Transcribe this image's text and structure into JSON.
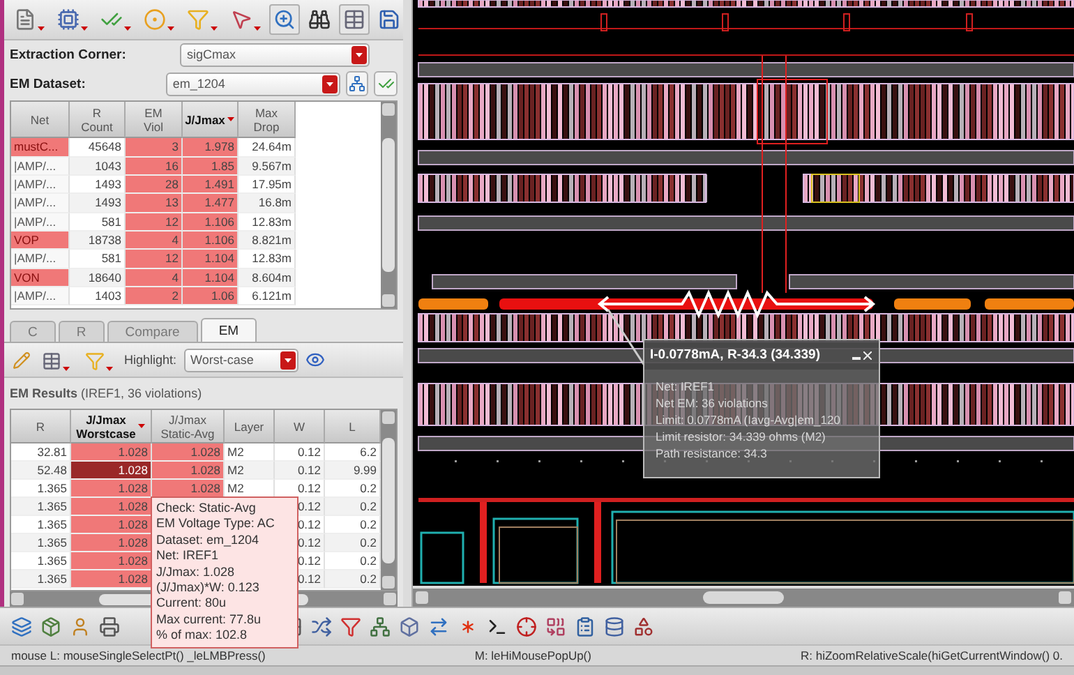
{
  "extraction_corner": {
    "label": "Extraction Corner:",
    "value": "sigCmax"
  },
  "em_dataset": {
    "label": "EM Dataset:",
    "value": "em_1204"
  },
  "net_table": {
    "columns": [
      {
        "label": "Net",
        "highlighted": false,
        "sorted": false
      },
      {
        "label": "R\nCount",
        "highlighted": false,
        "sorted": false
      },
      {
        "label": "EM\nViol",
        "highlighted": true,
        "sorted": false
      },
      {
        "label": "J/Jmax",
        "highlighted": true,
        "sorted": true
      },
      {
        "label": "Max\nDrop",
        "highlighted": false,
        "sorted": false
      }
    ],
    "rows": [
      {
        "cells": [
          "mustC...",
          "45648",
          "3",
          "1.978",
          "24.64m"
        ],
        "flagged": true
      },
      {
        "cells": [
          "|AMP/...",
          "1043",
          "16",
          "1.85",
          "9.567m"
        ],
        "flagged": false
      },
      {
        "cells": [
          "|AMP/...",
          "1493",
          "28",
          "1.491",
          "17.95m"
        ],
        "flagged": false
      },
      {
        "cells": [
          "|AMP/...",
          "1493",
          "13",
          "1.477",
          "16.8m"
        ],
        "flagged": false
      },
      {
        "cells": [
          "|AMP/...",
          "581",
          "12",
          "1.106",
          "12.83m"
        ],
        "flagged": false
      },
      {
        "cells": [
          "VOP",
          "18738",
          "4",
          "1.106",
          "8.821m"
        ],
        "flagged": true
      },
      {
        "cells": [
          "|AMP/...",
          "581",
          "12",
          "1.104",
          "12.83m"
        ],
        "flagged": false
      },
      {
        "cells": [
          "VON",
          "18640",
          "4",
          "1.104",
          "8.604m"
        ],
        "flagged": true
      },
      {
        "cells": [
          "|AMP/...",
          "1403",
          "2",
          "1.06",
          "6.121m"
        ],
        "flagged": false
      }
    ]
  },
  "tabs": [
    {
      "label": "C",
      "selected": false
    },
    {
      "label": "R",
      "selected": false
    },
    {
      "label": "Compare",
      "selected": false
    },
    {
      "label": "EM",
      "selected": true
    }
  ],
  "highlight": {
    "label": "Highlight:",
    "value": "Worst-case"
  },
  "results": {
    "title": "EM Results",
    "detail": "(IREF1, 36 violations)"
  },
  "results_table": {
    "columns": [
      {
        "label": "R",
        "highlighted": false,
        "sorted": false
      },
      {
        "label": "J/Jmax\nWorstcase",
        "highlighted": true,
        "sorted": true
      },
      {
        "label": "J/Jmax\nStatic-Avg",
        "highlighted": true,
        "sorted": false
      },
      {
        "label": "Layer",
        "highlighted": false,
        "sorted": false
      },
      {
        "label": "W",
        "highlighted": false,
        "sorted": false
      },
      {
        "label": "L",
        "highlighted": false,
        "sorted": false
      }
    ],
    "rows": [
      {
        "cells": [
          "32.81",
          "1.028",
          "1.028",
          "M2",
          "0.12",
          "6.2"
        ],
        "selected": false
      },
      {
        "cells": [
          "52.48",
          "1.028",
          "1.028",
          "M2",
          "0.12",
          "9.99"
        ],
        "selected": true
      },
      {
        "cells": [
          "1.365",
          "1.028",
          "1.028",
          "M2",
          "0.12",
          "0.2"
        ],
        "selected": false
      },
      {
        "cells": [
          "1.365",
          "1.028",
          null,
          null,
          "0.12",
          "0.2"
        ],
        "selected": false
      },
      {
        "cells": [
          "1.365",
          "1.028",
          null,
          null,
          "0.12",
          "0.2"
        ],
        "selected": false
      },
      {
        "cells": [
          "1.365",
          "1.028",
          null,
          null,
          "0.12",
          "0.2"
        ],
        "selected": false
      },
      {
        "cells": [
          "1.365",
          "1.028",
          null,
          null,
          "0.12",
          "0.2"
        ],
        "selected": false
      },
      {
        "cells": [
          "1.365",
          "1.028",
          null,
          null,
          "0.12",
          "0.2"
        ],
        "selected": false
      }
    ]
  },
  "tooltip": {
    "lines": [
      "Check: Static-Avg",
      "EM Voltage Type: AC",
      "Dataset: em_1204",
      "Net: IREF1",
      "J/Jmax: 1.028",
      "(J/Jmax)*W: 0.123",
      "Current: 80u",
      "Max current: 77.8u",
      "% of max: 102.8"
    ]
  },
  "canvas_popup": {
    "title": "I-0.0778mA, R-34.3 (34.339)",
    "lines": [
      "Net: IREF1",
      "Net EM: 36 violations",
      "Limit: 0.0778mA (Iavg-Avg|em_120",
      "Limit resistor: 34.339 ohms (M2)",
      "Path resistance: 34.3"
    ]
  },
  "status_bar": {
    "left": "mouse L: mouseSingleSelectPt() _leLMBPress()",
    "middle": "M: leHiMousePopUp()",
    "right": "R: hiZoomRelativeScale(hiGetCurrentWindow() 0."
  }
}
